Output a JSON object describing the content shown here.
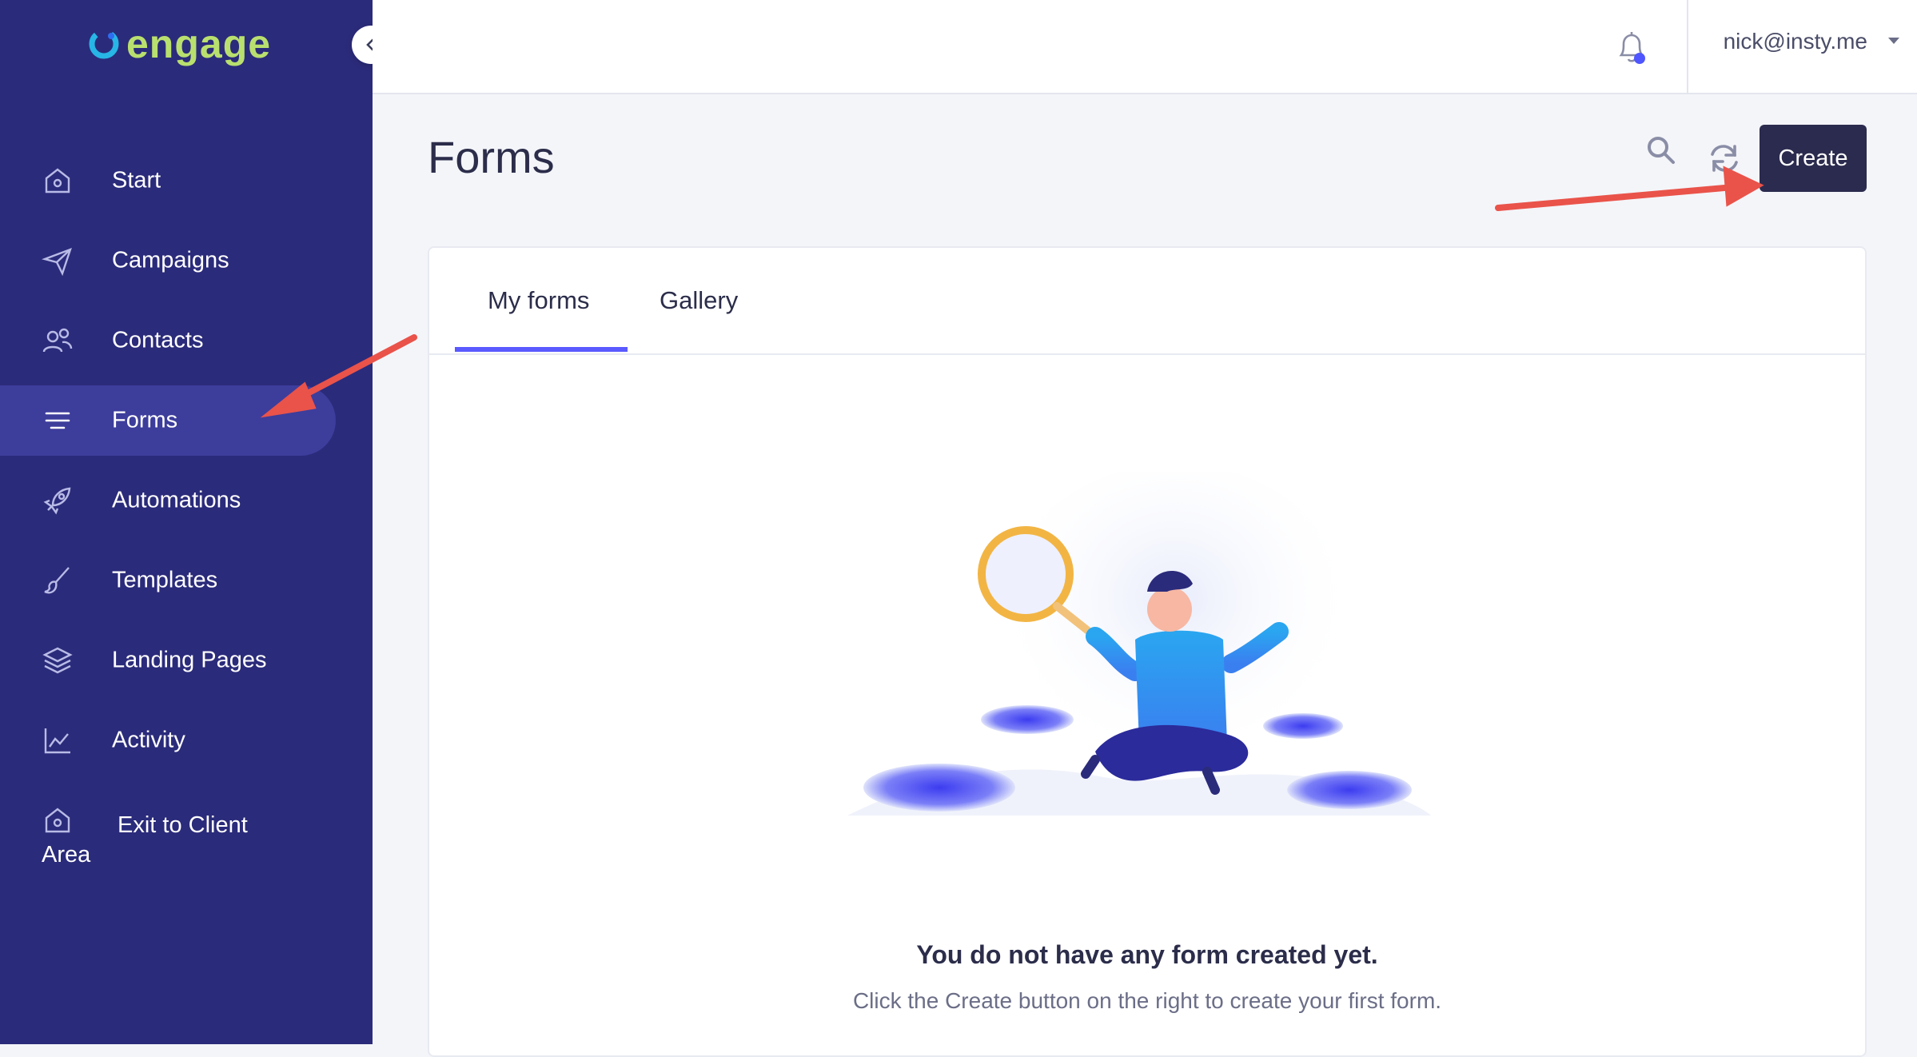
{
  "brand": {
    "name": "engage",
    "logo_color": "#b9e06e"
  },
  "sidebar": {
    "items": [
      {
        "label": "Start",
        "icon": "home-icon"
      },
      {
        "label": "Campaigns",
        "icon": "paper-plane-icon"
      },
      {
        "label": "Contacts",
        "icon": "users-icon"
      },
      {
        "label": "Forms",
        "icon": "menu-lines-icon",
        "active": true
      },
      {
        "label": "Automations",
        "icon": "rocket-icon"
      },
      {
        "label": "Templates",
        "icon": "brush-icon"
      },
      {
        "label": "Landing Pages",
        "icon": "layers-icon"
      },
      {
        "label": "Activity",
        "icon": "chart-line-icon"
      }
    ],
    "exit_label_line1": "Exit to Client",
    "exit_label_line2": "Area",
    "background": "#2b2b7b",
    "active_background": "#3d3d9c"
  },
  "topbar": {
    "user_email": "nick@insty.me",
    "notification_dot_color": "#4f56ff"
  },
  "main": {
    "title": "Forms",
    "create_label": "Create",
    "tabs": [
      {
        "label": "My forms",
        "active": true
      },
      {
        "label": "Gallery",
        "active": false
      }
    ],
    "empty_title": "You do not have any form created yet.",
    "empty_subtitle": "Click the Create button on the right to create your first form."
  },
  "colors": {
    "accent": "#5a5aff",
    "create_button": "#2b2b4f",
    "annotation_arrow": "#e9534a"
  }
}
